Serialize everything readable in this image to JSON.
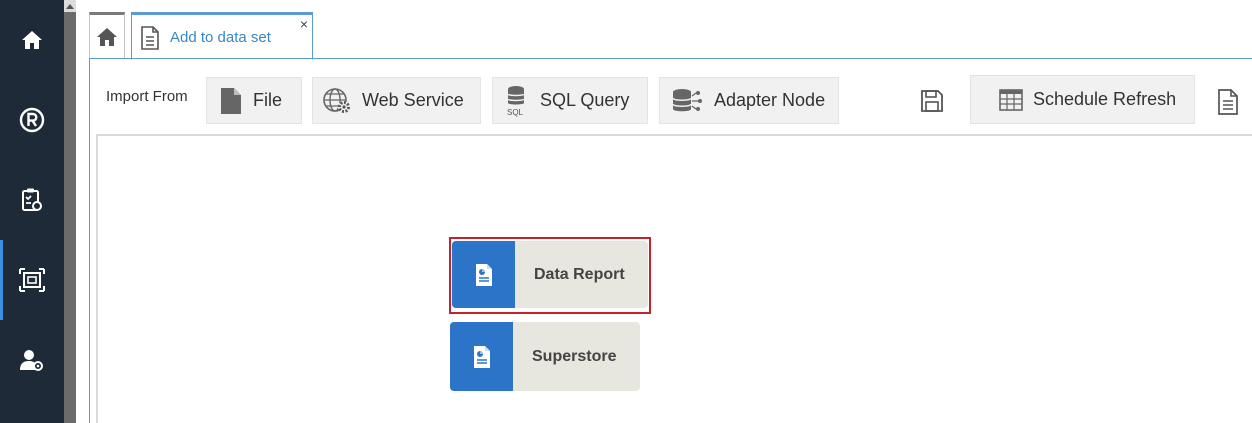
{
  "rail": {
    "items": [
      {
        "icon": "home-icon"
      },
      {
        "icon": "registered-icon"
      },
      {
        "icon": "clipboard-gear-icon"
      },
      {
        "icon": "frame-icon",
        "active": true
      },
      {
        "icon": "user-settings-icon"
      }
    ]
  },
  "tabs": {
    "home_icon": "home-icon",
    "active_label": "Add to data set",
    "close": "×"
  },
  "toolbar": {
    "import_label": "Import From",
    "file_label": "File",
    "web_service_label": "Web Service",
    "sql_query_label": "SQL Query",
    "adapter_node_label": "Adapter Node",
    "schedule_refresh_label": "Schedule Refresh"
  },
  "nodes": [
    {
      "label": "Data Report",
      "selected": true
    },
    {
      "label": "Superstore",
      "selected": false
    }
  ],
  "colors": {
    "rail": "#1f2a38",
    "accent": "#2b74c8",
    "tab_accent": "#3a86c8",
    "selection": "#c4232b"
  }
}
